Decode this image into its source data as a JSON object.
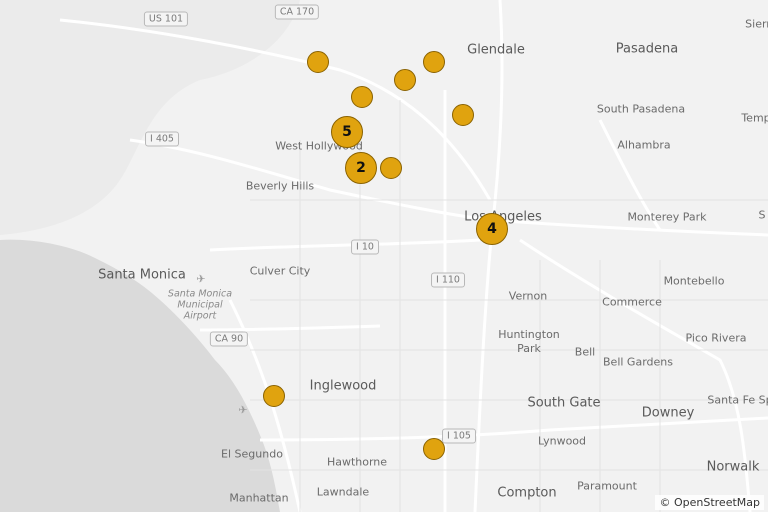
{
  "attribution": "© OpenStreetMap",
  "colors": {
    "marker_fill": "#e0a30f",
    "marker_border": "#8a6200",
    "land": "#f2f2f2",
    "water": "#dadada",
    "road": "#ffffff"
  },
  "places": [
    {
      "name": "Glendale"
    },
    {
      "name": "Pasadena"
    },
    {
      "name": "Sierr"
    },
    {
      "name": "South Pasadena"
    },
    {
      "name": "Temp"
    },
    {
      "name": "Alhambra"
    },
    {
      "name": "West Hollywood"
    },
    {
      "name": "Beverly Hills"
    },
    {
      "name": "Los Angeles"
    },
    {
      "name": "Monterey Park"
    },
    {
      "name": "Santa Monica"
    },
    {
      "name": "Culver City"
    },
    {
      "name": "Vernon"
    },
    {
      "name": "Commerce"
    },
    {
      "name": "Montebello"
    },
    {
      "name": "Huntington\nPark"
    },
    {
      "name": "Bell"
    },
    {
      "name": "Pico Rivera"
    },
    {
      "name": "Bell Gardens"
    },
    {
      "name": "Inglewood"
    },
    {
      "name": "South Gate"
    },
    {
      "name": "Downey"
    },
    {
      "name": "Santa Fe Sp"
    },
    {
      "name": "El Segundo"
    },
    {
      "name": "Hawthorne"
    },
    {
      "name": "Lynwood"
    },
    {
      "name": "Norwalk"
    },
    {
      "name": "Paramount"
    },
    {
      "name": "Manhattan"
    },
    {
      "name": "Lawndale"
    },
    {
      "name": "Compton"
    },
    {
      "name": "S"
    }
  ],
  "airport_label": "Santa Monica\nMunicipal\nAirport",
  "shields": [
    "US 101",
    "CA 170",
    "I 405",
    "I 10",
    "I 110",
    "CA 90",
    "I 105"
  ],
  "clusters": [
    {
      "label": ""
    },
    {
      "label": ""
    },
    {
      "label": ""
    },
    {
      "label": ""
    },
    {
      "label": ""
    },
    {
      "label": "5"
    },
    {
      "label": "2"
    },
    {
      "label": ""
    },
    {
      "label": "4"
    },
    {
      "label": ""
    },
    {
      "label": ""
    }
  ]
}
